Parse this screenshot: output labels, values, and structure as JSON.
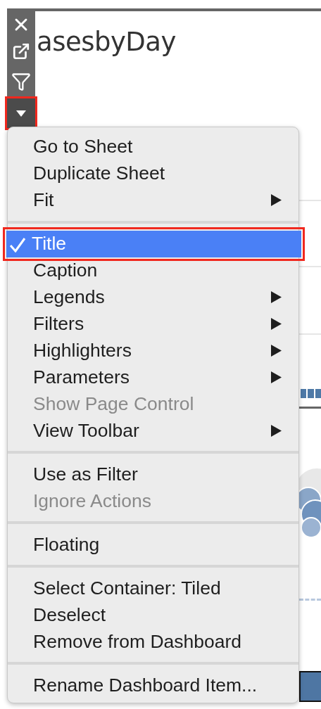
{
  "sheet": {
    "title": "asesbyDay"
  },
  "toolbar": {
    "buttons": [
      {
        "kind": "close"
      },
      {
        "kind": "open"
      },
      {
        "kind": "filter"
      },
      {
        "kind": "more",
        "highlighted": true
      }
    ]
  },
  "menu": {
    "sections": [
      [
        {
          "label": "Go to Sheet",
          "submenu": false,
          "disabled": false,
          "checked": false,
          "selected": false,
          "highlighted": false
        },
        {
          "label": "Duplicate Sheet",
          "submenu": false,
          "disabled": false,
          "checked": false,
          "selected": false,
          "highlighted": false
        },
        {
          "label": "Fit",
          "submenu": true,
          "disabled": false,
          "checked": false,
          "selected": false,
          "highlighted": false
        }
      ],
      [
        {
          "label": "Title",
          "submenu": false,
          "disabled": false,
          "checked": true,
          "selected": true,
          "highlighted": true
        },
        {
          "label": "Caption",
          "submenu": false,
          "disabled": false,
          "checked": false,
          "selected": false,
          "highlighted": false
        },
        {
          "label": "Legends",
          "submenu": true,
          "disabled": false,
          "checked": false,
          "selected": false,
          "highlighted": false
        },
        {
          "label": "Filters",
          "submenu": true,
          "disabled": false,
          "checked": false,
          "selected": false,
          "highlighted": false
        },
        {
          "label": "Highlighters",
          "submenu": true,
          "disabled": false,
          "checked": false,
          "selected": false,
          "highlighted": false
        },
        {
          "label": "Parameters",
          "submenu": true,
          "disabled": false,
          "checked": false,
          "selected": false,
          "highlighted": false
        },
        {
          "label": "Show Page Control",
          "submenu": false,
          "disabled": true,
          "checked": false,
          "selected": false,
          "highlighted": false
        },
        {
          "label": "View Toolbar",
          "submenu": true,
          "disabled": false,
          "checked": false,
          "selected": false,
          "highlighted": false
        }
      ],
      [
        {
          "label": "Use as Filter",
          "submenu": false,
          "disabled": false,
          "checked": false,
          "selected": false,
          "highlighted": false
        },
        {
          "label": "Ignore Actions",
          "submenu": false,
          "disabled": true,
          "checked": false,
          "selected": false,
          "highlighted": false
        }
      ],
      [
        {
          "label": "Floating",
          "submenu": false,
          "disabled": false,
          "checked": false,
          "selected": false,
          "highlighted": false
        }
      ],
      [
        {
          "label": "Select Container: Tiled",
          "submenu": false,
          "disabled": false,
          "checked": false,
          "selected": false,
          "highlighted": false
        },
        {
          "label": "Deselect",
          "submenu": false,
          "disabled": false,
          "checked": false,
          "selected": false,
          "highlighted": false
        },
        {
          "label": "Remove from Dashboard",
          "submenu": false,
          "disabled": false,
          "checked": false,
          "selected": false,
          "highlighted": false
        }
      ],
      [
        {
          "label": "Rename Dashboard Item...",
          "submenu": false,
          "disabled": false,
          "checked": false,
          "selected": false,
          "highlighted": false
        }
      ]
    ]
  }
}
